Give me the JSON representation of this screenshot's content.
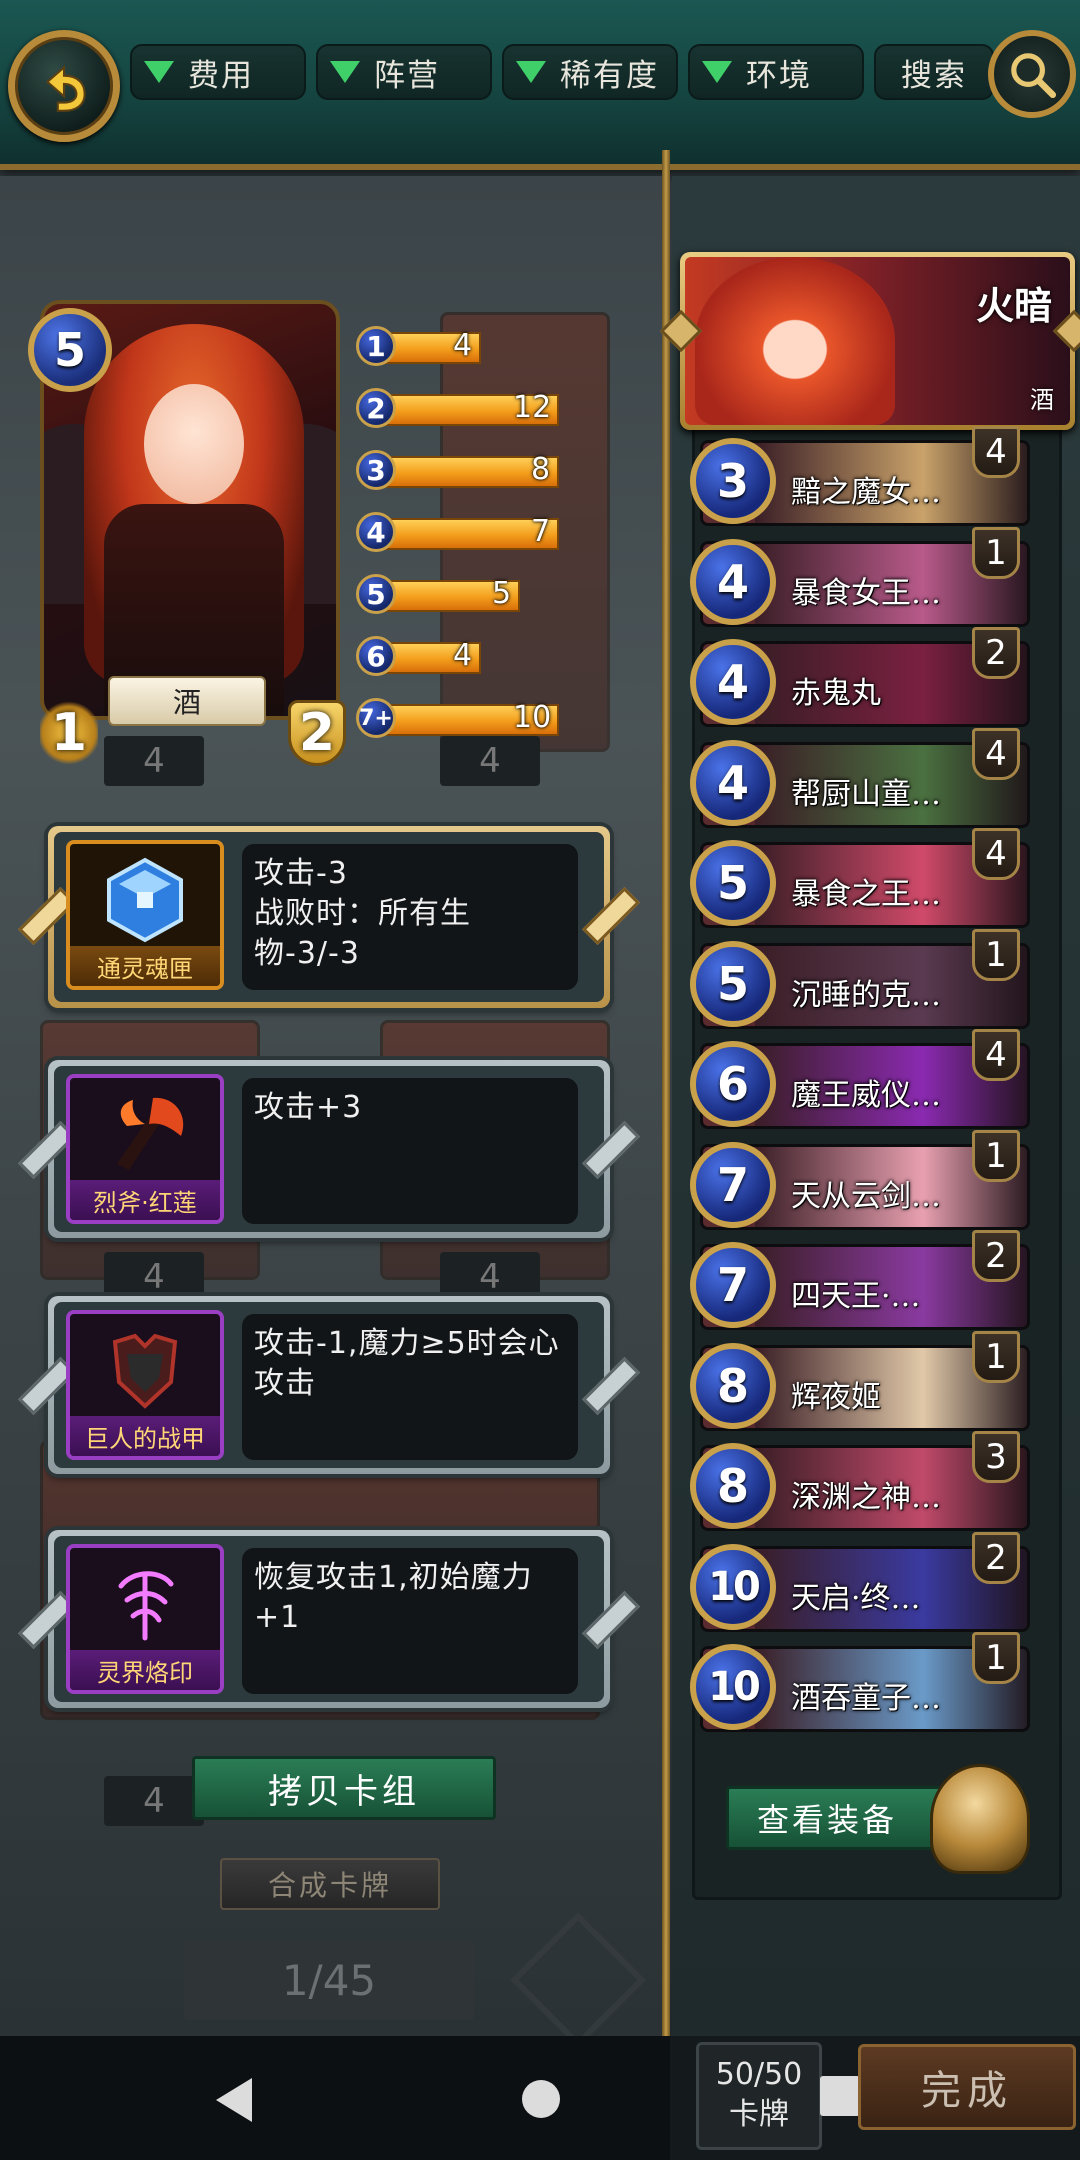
{
  "topbar": {
    "filters": [
      "费用",
      "阵营",
      "稀有度",
      "环境"
    ],
    "search_label": "搜索"
  },
  "hero": {
    "cost": "5",
    "name": "酒",
    "attack": "1",
    "health": "2"
  },
  "cost_curve": [
    {
      "cost": "1",
      "count": "4",
      "fill": 0.4
    },
    {
      "cost": "2",
      "count": "12",
      "fill": 0.7
    },
    {
      "cost": "3",
      "count": "8",
      "fill": 0.7
    },
    {
      "cost": "4",
      "count": "7",
      "fill": 0.7
    },
    {
      "cost": "5",
      "count": "5",
      "fill": 0.55
    },
    {
      "cost": "6",
      "count": "4",
      "fill": 0.4
    },
    {
      "cost": "7+",
      "count": "10",
      "fill": 0.7
    }
  ],
  "equipment": [
    {
      "name": "通灵魂匣",
      "desc": "攻击-3\n战败时：所有生物-3/-3",
      "rarity": "legendary",
      "color": "#4aa8ff"
    },
    {
      "name": "烈斧·红莲",
      "desc": "攻击+3",
      "rarity": "epic",
      "color": "#e24a1e"
    },
    {
      "name": "巨人的战甲",
      "desc": "攻击-1,魔力≥5时会心攻击",
      "rarity": "epic",
      "color": "#b0342a"
    },
    {
      "name": "灵界烙印",
      "desc": "恢复攻击1,初始魔力+1",
      "rarity": "epic",
      "color": "#d44ad8"
    }
  ],
  "faded_counts": [
    "4",
    "4",
    "4",
    "4",
    "4"
  ],
  "buttons": {
    "copy_deck": "拷贝卡组",
    "craft": "合成卡牌",
    "page": "1/45",
    "view_equipment": "查看装备",
    "done": "完成"
  },
  "leader": {
    "name": "火暗",
    "sub": "酒"
  },
  "deck": [
    {
      "cost": "3",
      "name": "黯之魔女…",
      "count": "4",
      "tint": "#c9a26a"
    },
    {
      "cost": "4",
      "name": "暴食女王…",
      "count": "1",
      "tint": "#b85a8a"
    },
    {
      "cost": "4",
      "name": "赤鬼丸",
      "count": "2",
      "tint": "#7a2040"
    },
    {
      "cost": "4",
      "name": "帮厨山童…",
      "count": "4",
      "tint": "#4a7040"
    },
    {
      "cost": "5",
      "name": "暴食之王…",
      "count": "4",
      "tint": "#d04a6a"
    },
    {
      "cost": "5",
      "name": "沉睡的克…",
      "count": "1",
      "tint": "#5a3a50"
    },
    {
      "cost": "6",
      "name": "魔王威仪…",
      "count": "4",
      "tint": "#8a2ab0"
    },
    {
      "cost": "7",
      "name": "天从云剑…",
      "count": "1",
      "tint": "#e8a0b0"
    },
    {
      "cost": "7",
      "name": "四天王·…",
      "count": "2",
      "tint": "#8a3aa0"
    },
    {
      "cost": "8",
      "name": "辉夜姬",
      "count": "1",
      "tint": "#e0c8a8"
    },
    {
      "cost": "8",
      "name": "深渊之神…",
      "count": "3",
      "tint": "#c04a6a"
    },
    {
      "cost": "10",
      "name": "天启·终…",
      "count": "2",
      "tint": "#3a3aa0"
    },
    {
      "cost": "10",
      "name": "酒吞童子…",
      "count": "1",
      "tint": "#6a9ac8"
    }
  ],
  "deck_total": {
    "value": "50/50",
    "label": "卡牌"
  }
}
